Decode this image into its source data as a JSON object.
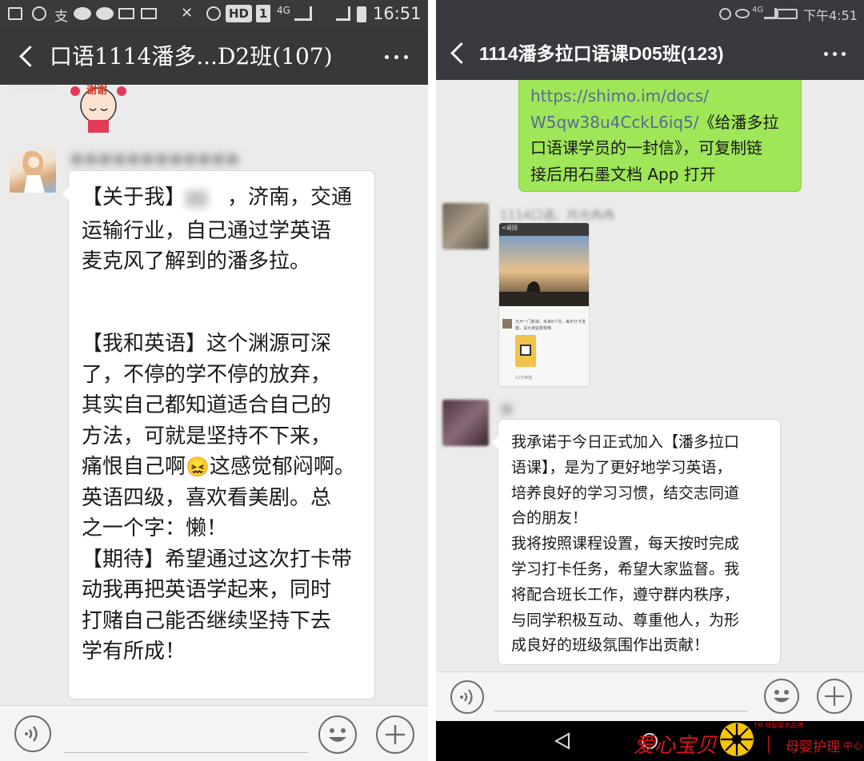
{
  "left_phone": {
    "status": {
      "hd": "HD",
      "sim": "1",
      "net": "4G",
      "time": "16:51"
    },
    "title": "口语1114潘多...D2班(107)",
    "sticker_text": "谢谢",
    "message": {
      "sender_name": "●●●●●●●●●●●●",
      "lines": [
        "【关于我】",
        "，济南，交通",
        "运输行业，自己通过学英语",
        "麦克风了解到的潘多拉。",
        "【我和英语】这个渊源可深",
        "了，不停的学不停的放弃，",
        "其实自己都知道适合自己的",
        "方法，可就是坚持不下来，",
        "痛恨自己啊",
        "这感觉郁闷啊。",
        "英语四级，喜欢看美剧。总",
        "之一个字：懒！",
        "【期待】希望通过这次打卡带",
        "动我再把英语学起来，同时",
        "打赌自己能否继续坚持下去",
        "学有所成！"
      ],
      "emoji": "😖"
    }
  },
  "right_phone": {
    "status": {
      "net": "4G",
      "time": "下午4:51"
    },
    "title": "1114潘多拉口语课D05班(123)",
    "green_message": {
      "link_line1": "https://shimo.im/docs/",
      "link_line2": "W5qw38u4CckL6iq5/",
      "text_line2": "《给潘多拉",
      "text_line3": "口语课学员的一封信》，可复制链",
      "text_line4": "接后用石墨文档 App 打开"
    },
    "image_sender_name": "1114口语。月光冉冉",
    "thumb": {
      "back_label": "<返回",
      "post_text": "又开一门新课，未来6个月，每天打卡发圈，请大家监督我哦",
      "footer_text": "11分钟前"
    },
    "pledge_sender_name": "●",
    "pledge": [
      "我承诺于今日正式加入【潘多拉口",
      "语课】，是为了更好地学习英语，",
      "培养良好的学习习惯，结交志同道",
      "合的朋友！",
      "我将按照课程设置，每天按时完成",
      "学习打卡任务，希望大家监督。我",
      "将配合班长工作，遵守群内秩序，",
      "与同学积极互动、尊重他人，为形",
      "成良好的班级氛围作出贡献！"
    ]
  },
  "watermark": {
    "brand": "爱心宝贝",
    "tag": "母婴护理",
    "suffix": "中心",
    "small": "TM 母婴服务品牌"
  },
  "colors": {
    "titlebar": "#383838",
    "chat_bg": "#ebebeb",
    "green_bubble": "#9fe658",
    "link_blue": "#576b95",
    "watermark_red": "#d8141a",
    "watermark_yellow": "#f7c500"
  }
}
